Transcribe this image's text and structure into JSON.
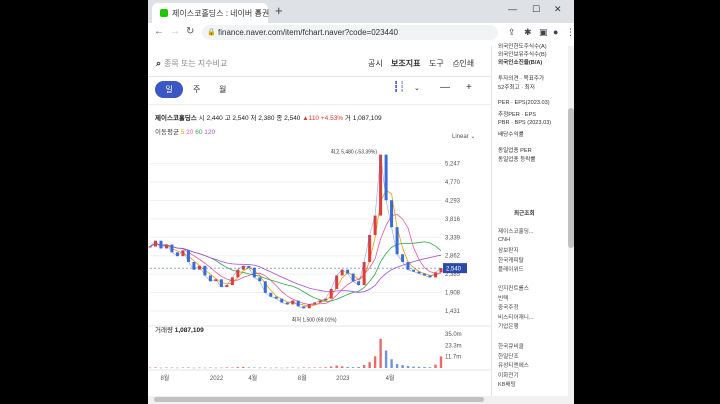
{
  "browser": {
    "tab_title": "제이스코홀딩스 : 네이버 증권",
    "url": "finance.naver.com/item/fchart.naver?code=023440"
  },
  "toolbar": {
    "search_placeholder": "종목 또는 지수비교",
    "items": [
      "공시",
      "보조지표",
      "도구",
      "인쇄"
    ]
  },
  "periods": [
    "일",
    "주",
    "월"
  ],
  "stock": {
    "name": "제이스코홀딩스",
    "open_label": "시",
    "open": "2,440",
    "high_label": "고",
    "high": "2,540",
    "low_label": "저",
    "low": "2,380",
    "close_label": "종",
    "close": "2,540",
    "change": "▲110",
    "change_pct": "+4.53%",
    "volume_label": "거",
    "volume": "1,087,109"
  },
  "moving_average": {
    "label": "이동평균",
    "periods": [
      "5",
      "20",
      "60",
      "120"
    ],
    "colors": [
      "#f0a000",
      "#e85aa0",
      "#2ea84a",
      "#a64fd8"
    ]
  },
  "scale": "Linear",
  "chart_data": {
    "type": "line",
    "price_ticks": [
      "5,247",
      "4,770",
      "4,293",
      "3,816",
      "3,339",
      "2,862",
      "2,385",
      "1,908",
      "1,431"
    ],
    "current_price": "2,540",
    "high_annotation": "최고 5,480 (-53.39%)",
    "low_annotation": "최저 1,500 (69.01%)",
    "x_ticks": [
      "8월",
      "2022",
      "4월",
      "8월",
      "2023",
      "4월"
    ],
    "volume_label": "거래량",
    "volume": "1,087,109",
    "volume_ticks": [
      "35.0m",
      "23.3m",
      "11.7m"
    ],
    "price_series": [
      3100,
      3250,
      3050,
      3150,
      2950,
      2850,
      3000,
      2700,
      2500,
      2600,
      2350,
      2200,
      2250,
      2050,
      2100,
      2300,
      2500,
      2600,
      2550,
      2300,
      2200,
      1900,
      1800,
      1750,
      1650,
      1600,
      1700,
      1550,
      1500,
      1600,
      1650,
      1700,
      1750,
      2000,
      2350,
      2500,
      2400,
      2200,
      2100,
      2700,
      3400,
      3900,
      5480,
      4300,
      3600,
      2900,
      2700,
      2500,
      2450,
      2400,
      2350,
      2300,
      2430,
      2540
    ],
    "volume_series": [
      0.4,
      0.6,
      0.3,
      0.5,
      0.4,
      0.3,
      0.5,
      0.6,
      0.3,
      0.4,
      0.3,
      0.5,
      0.3,
      0.4,
      0.6,
      0.5,
      0.9,
      1.2,
      0.6,
      0.5,
      0.4,
      0.5,
      0.3,
      0.4,
      0.3,
      0.4,
      0.5,
      0.3,
      0.6,
      0.4,
      0.5,
      0.6,
      0.8,
      1.5,
      2.5,
      1.8,
      1.1,
      0.8,
      1.0,
      3.0,
      6.0,
      12.0,
      30.0,
      18.0,
      9.0,
      4.0,
      3.0,
      2.0,
      1.5,
      1.2,
      1.0,
      0.8,
      3.5,
      12.0
    ]
  },
  "right_panel": {
    "ownership": [
      "외국인한도주식수(A)",
      "외국인보유주식수(B)",
      "외국인소진율(B/A)"
    ],
    "opinion": [
      "투자의견 · 목표주가",
      "52주최고 · 최저"
    ],
    "valuation": [
      "PER · EPS(2023.03)",
      "추정PER · EPS",
      "PBR · BPS (2023.03)",
      "배당수익률"
    ],
    "industry": [
      "동일업종 PER",
      "동일업종 등락률"
    ],
    "recent_title": "최근조회",
    "recent": [
      "제이스코홀딩...",
      "CNH",
      "삼보판지",
      "한국캐피탈",
      "플레이위드"
    ],
    "group2": [
      "인지컨트롤스",
      "빈텍",
      "중국주정",
      "비스티어재니...",
      "기업은행"
    ],
    "group3": [
      "한국큐비클",
      "한일단조",
      "유성티엔에스",
      "이화전기",
      "KB배팅"
    ]
  }
}
